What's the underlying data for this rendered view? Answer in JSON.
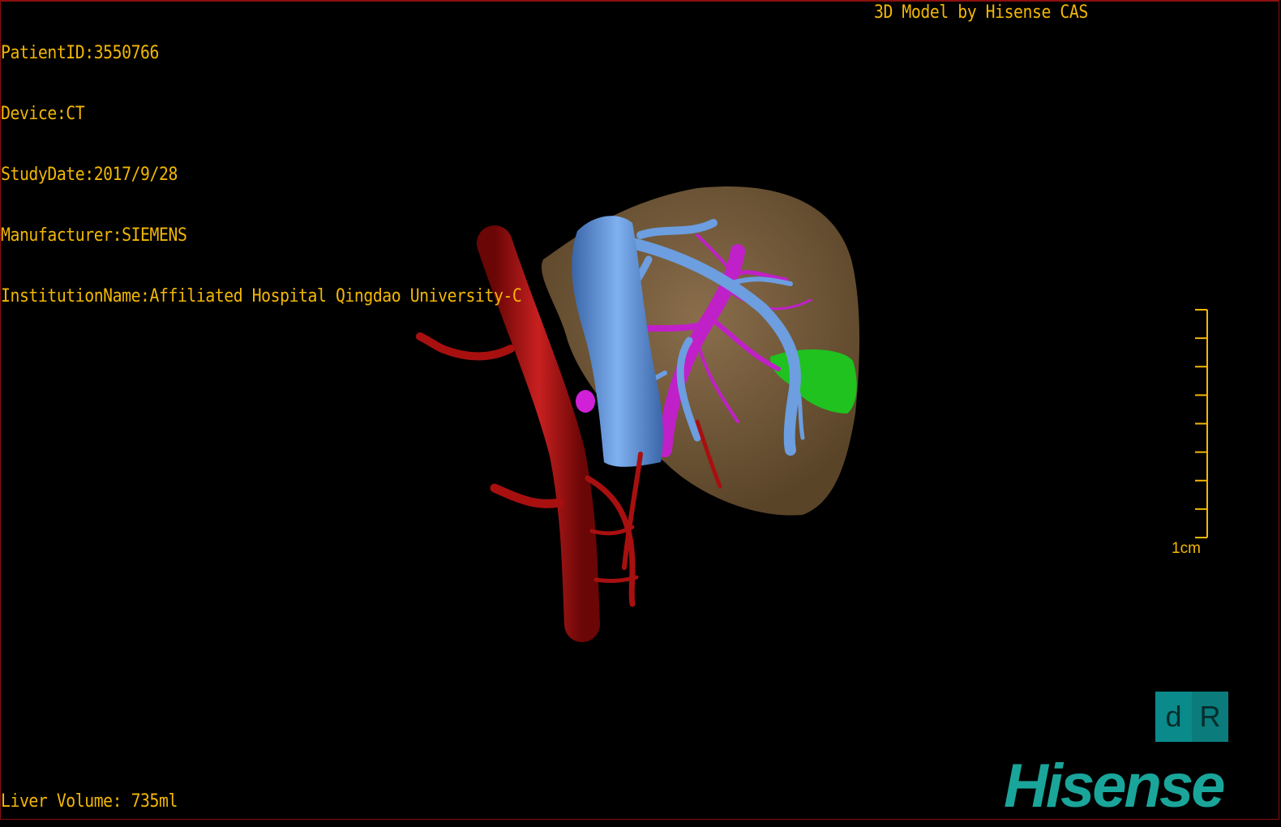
{
  "header": {
    "patient_id": "PatientID:3550766",
    "device": "Device:CT",
    "study_date": "StudyDate:2017/9/28",
    "manufacturer": "Manufacturer:SIEMENS",
    "institution": "InstitutionName:Affiliated Hospital Qingdao University-C",
    "brand": "3D Model by Hisense CAS"
  },
  "footer": {
    "liver_volume": "Liver Volume: 735ml"
  },
  "scale_bar": {
    "label": "1cm",
    "ticks": 9
  },
  "orientation_cube": {
    "left": "d",
    "right": "R"
  },
  "logo": {
    "text": "Hisense"
  },
  "colors": {
    "text": "#f2b705",
    "liver": "#7a6040",
    "ivc": "#5b8fd6",
    "artery": "#b01010",
    "portal": "#c020c8",
    "green": "#20c020",
    "logo": "#1aa59a"
  }
}
